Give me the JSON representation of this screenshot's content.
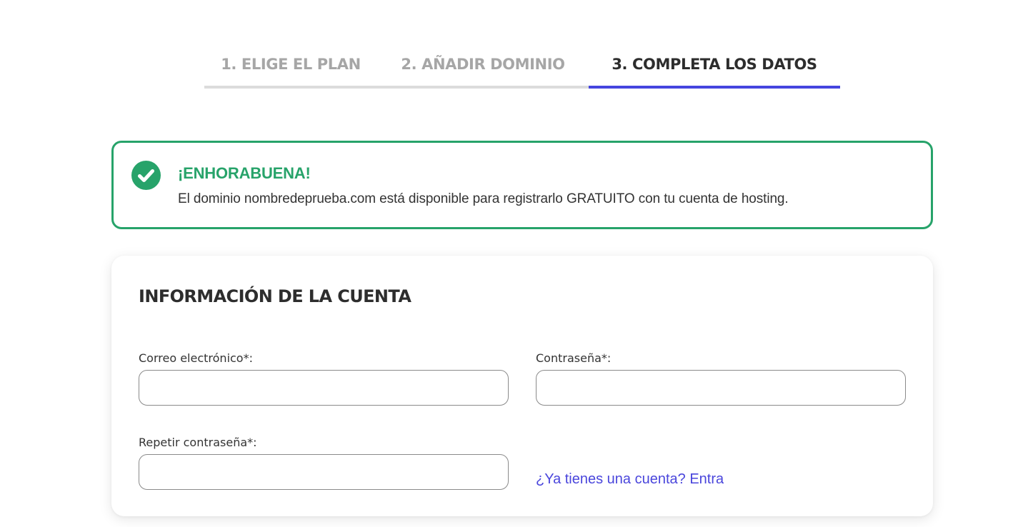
{
  "steps": [
    {
      "label": "1. ELIGE EL PLAN",
      "active": false
    },
    {
      "label": "2. AÑADIR DOMINIO",
      "active": false
    },
    {
      "label": "3. COMPLETA LOS DATOS",
      "active": true
    }
  ],
  "alert": {
    "icon": "check-circle-icon",
    "title": "¡ENHORABUENA!",
    "text": "El dominio nombredeprueba.com está disponible para registrarlo GRATUITO con tu cuenta de hosting."
  },
  "account": {
    "title": "INFORMACIÓN DE LA CUENTA",
    "email_label": "Correo electrónico*:",
    "email_value": "",
    "password_label": "Contraseña*:",
    "password_value": "",
    "repeat_label": "Repetir contraseña*:",
    "repeat_value": "",
    "login_link": "¿Ya tienes una cuenta? Entra"
  },
  "colors": {
    "accent": "#4545df",
    "success": "#27a36a",
    "link": "#4a46dc",
    "inactive_step": "#a6a6a6",
    "text_dark": "#2d2d2d"
  }
}
